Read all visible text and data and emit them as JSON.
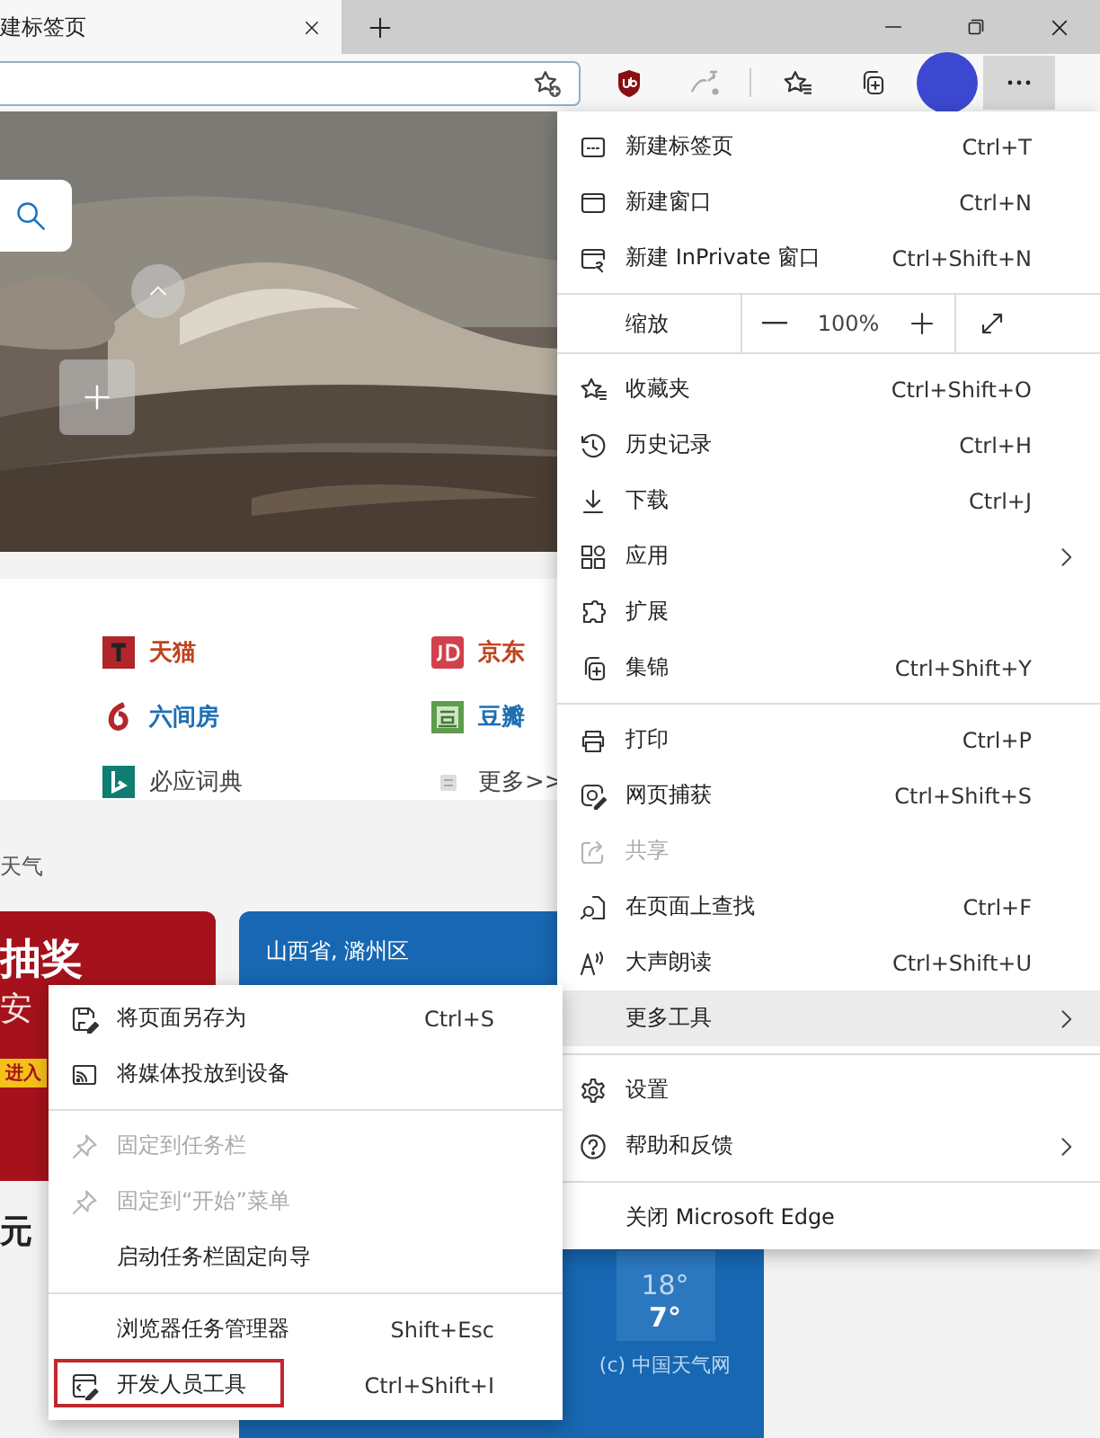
{
  "tab": {
    "title": "建标签页"
  },
  "toolbar": {
    "more_pressed": true
  },
  "new_tab_page": {
    "quick_links": [
      {
        "label": "天猫",
        "color": "#c0441e"
      },
      {
        "label": "京东",
        "color": "#c0441e"
      },
      {
        "label": "六间房",
        "color": "#1f6fb2"
      },
      {
        "label": "豆瓣",
        "color": "#1f6fb2"
      },
      {
        "label": "必应词典",
        "color": "#444444"
      },
      {
        "label": "更多>>",
        "color": "#444444"
      }
    ],
    "weather_heading": "天气",
    "promo_card": {
      "title": "抽奖",
      "subtitle": "安",
      "badge": "进入",
      "caption": "元"
    },
    "weather_card": {
      "location": "山西省, 潞州区",
      "high": "18°",
      "low": "7°",
      "source": "(c) 中国天气网"
    }
  },
  "main_menu": {
    "items": [
      {
        "kind": "item",
        "label": "新建标签页",
        "shortcut": "Ctrl+T",
        "has_submenu": false,
        "disabled": false,
        "selected": false
      },
      {
        "kind": "item",
        "label": "新建窗口",
        "shortcut": "Ctrl+N",
        "has_submenu": false,
        "disabled": false,
        "selected": false
      },
      {
        "kind": "item",
        "label": "新建 InPrivate 窗口",
        "shortcut": "Ctrl+Shift+N",
        "has_submenu": false,
        "disabled": false,
        "selected": false
      },
      {
        "kind": "separator"
      },
      {
        "kind": "zoom",
        "label": "缩放",
        "value": "100%"
      },
      {
        "kind": "separator"
      },
      {
        "kind": "item",
        "label": "收藏夹",
        "shortcut": "Ctrl+Shift+O",
        "has_submenu": false,
        "disabled": false,
        "selected": false
      },
      {
        "kind": "item",
        "label": "历史记录",
        "shortcut": "Ctrl+H",
        "has_submenu": false,
        "disabled": false,
        "selected": false
      },
      {
        "kind": "item",
        "label": "下载",
        "shortcut": "Ctrl+J",
        "has_submenu": false,
        "disabled": false,
        "selected": false
      },
      {
        "kind": "item",
        "label": "应用",
        "has_submenu": true,
        "disabled": false,
        "selected": false
      },
      {
        "kind": "item",
        "label": "扩展",
        "has_submenu": false,
        "disabled": false,
        "selected": false
      },
      {
        "kind": "item",
        "label": "集锦",
        "shortcut": "Ctrl+Shift+Y",
        "has_submenu": false,
        "disabled": false,
        "selected": false
      },
      {
        "kind": "separator"
      },
      {
        "kind": "item",
        "label": "打印",
        "shortcut": "Ctrl+P",
        "has_submenu": false,
        "disabled": false,
        "selected": false
      },
      {
        "kind": "item",
        "label": "网页捕获",
        "shortcut": "Ctrl+Shift+S",
        "has_submenu": false,
        "disabled": false,
        "selected": false
      },
      {
        "kind": "item",
        "label": "共享",
        "has_submenu": false,
        "disabled": true,
        "selected": false
      },
      {
        "kind": "item",
        "label": "在页面上查找",
        "shortcut": "Ctrl+F",
        "has_submenu": false,
        "disabled": false,
        "selected": false
      },
      {
        "kind": "item",
        "label": "大声朗读",
        "shortcut": "Ctrl+Shift+U",
        "has_submenu": false,
        "disabled": false,
        "selected": false
      },
      {
        "kind": "item",
        "label": "更多工具",
        "has_submenu": true,
        "disabled": false,
        "selected": true
      },
      {
        "kind": "separator"
      },
      {
        "kind": "item",
        "label": "设置",
        "has_submenu": false,
        "disabled": false,
        "selected": false
      },
      {
        "kind": "item",
        "label": "帮助和反馈",
        "has_submenu": true,
        "disabled": false,
        "selected": false
      },
      {
        "kind": "separator"
      },
      {
        "kind": "item",
        "label": "关闭 Microsoft Edge",
        "has_submenu": false,
        "disabled": false,
        "selected": false
      }
    ]
  },
  "sub_menu": {
    "items": [
      {
        "kind": "item",
        "label": "将页面另存为",
        "shortcut": "Ctrl+S",
        "disabled": false,
        "outlined": false
      },
      {
        "kind": "item",
        "label": "将媒体投放到设备",
        "disabled": false,
        "outlined": false
      },
      {
        "kind": "separator"
      },
      {
        "kind": "item",
        "label": "固定到任务栏",
        "disabled": true,
        "outlined": false
      },
      {
        "kind": "item",
        "label": "固定到“开始”菜单",
        "disabled": true,
        "outlined": false
      },
      {
        "kind": "item",
        "label": "启动任务栏固定向导",
        "disabled": false,
        "outlined": false
      },
      {
        "kind": "separator"
      },
      {
        "kind": "item",
        "label": "浏览器任务管理器",
        "shortcut": "Shift+Esc",
        "disabled": false,
        "outlined": false
      },
      {
        "kind": "item",
        "label": "开发人员工具",
        "shortcut": "Ctrl+Shift+I",
        "disabled": false,
        "outlined": true
      }
    ]
  }
}
